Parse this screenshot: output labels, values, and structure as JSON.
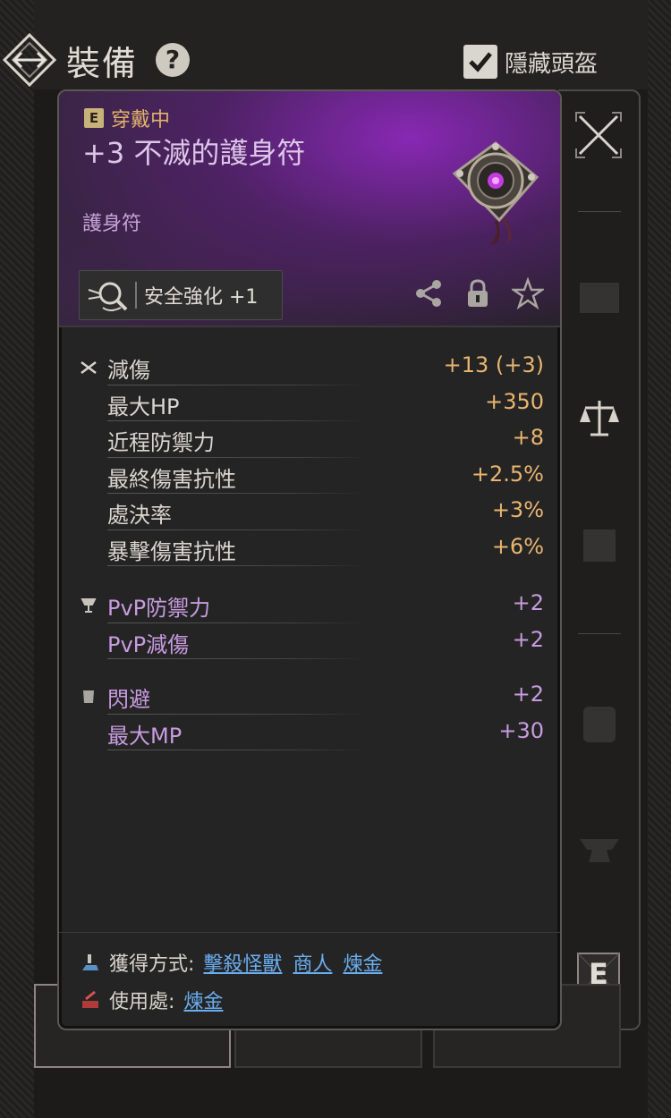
{
  "header": {
    "title": "裝備",
    "help_icon": "?",
    "hide_helmet_label": "隱藏頭盔",
    "hide_helmet_checked": true
  },
  "item": {
    "equipped_badge_letter": "E",
    "equipped_label": "穿戴中",
    "name": "+3 不滅的護身符",
    "type": "護身符",
    "enhance_label": "安全強化 +1",
    "rarity_color": "#8a2bbf"
  },
  "stats": {
    "main": [
      {
        "name": "減傷",
        "value": "+13 (+3)",
        "icon": "crossed-swords-icon",
        "color": "#e8b570"
      },
      {
        "name": "最大HP",
        "value": "+350",
        "color": "#e8b570"
      },
      {
        "name": "近程防禦力",
        "value": "+8",
        "color": "#e8b570"
      },
      {
        "name": "最終傷害抗性",
        "value": "+2.5%",
        "color": "#e8b570"
      },
      {
        "name": "處決率",
        "value": "+3%",
        "color": "#e8b570"
      },
      {
        "name": "暴擊傷害抗性",
        "value": "+6%",
        "color": "#e8b570"
      }
    ],
    "pvp": [
      {
        "name": "PvP防禦力",
        "value": "+2",
        "icon": "trophy-icon"
      },
      {
        "name": "PvP減傷",
        "value": "+2"
      }
    ],
    "extra": [
      {
        "name": "閃避",
        "value": "+2",
        "icon": "scroll-icon"
      },
      {
        "name": "最大MP",
        "value": "+30"
      }
    ]
  },
  "footer": {
    "obtain_label": "獲得方式:",
    "obtain_links": [
      "擊殺怪獸",
      "商人",
      "煉金"
    ],
    "use_label": "使用處:",
    "use_links": [
      "煉金"
    ]
  },
  "side": {
    "e_button": "E"
  }
}
